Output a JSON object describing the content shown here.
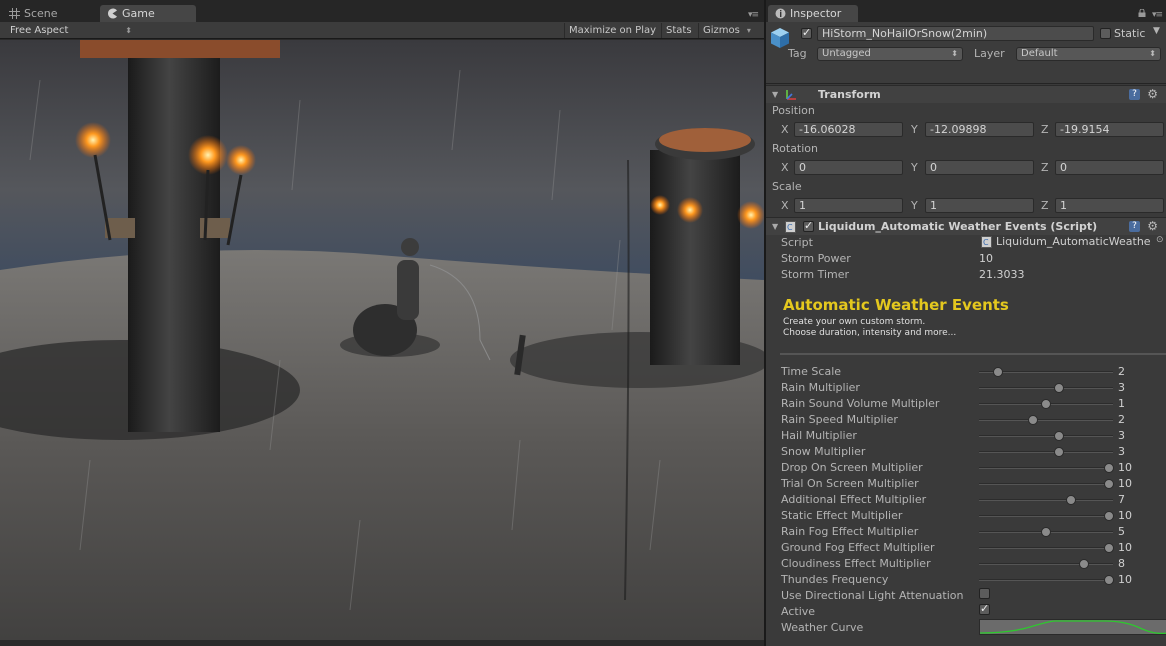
{
  "left_tabs": {
    "scene": "Scene",
    "game": "Game"
  },
  "game_toolbar": {
    "aspect": "Free Aspect",
    "maximize": "Maximize on Play",
    "stats": "Stats",
    "gizmos": "Gizmos"
  },
  "inspector": {
    "tab": "Inspector",
    "object_name": "HiStorm_NoHailOrSnow(2min)",
    "static_label": "Static",
    "tag_label": "Tag",
    "tag_value": "Untagged",
    "layer_label": "Layer",
    "layer_value": "Default",
    "transform": {
      "title": "Transform",
      "position_label": "Position",
      "rotation_label": "Rotation",
      "scale_label": "Scale",
      "position": {
        "x": "-16.06028",
        "y": "-12.09898",
        "z": "-19.9154"
      },
      "rotation": {
        "x": "0",
        "y": "0",
        "z": "0"
      },
      "scale": {
        "x": "1",
        "y": "1",
        "z": "1"
      },
      "x": "X",
      "y": "Y",
      "z": "Z"
    },
    "script_comp": {
      "title": "Liquidum_Automatic Weather Events (Script)",
      "script_label": "Script",
      "script_value": "Liquidum_AutomaticWeathe",
      "storm_power_label": "Storm Power",
      "storm_power": "10",
      "storm_timer_label": "Storm Timer",
      "storm_timer": "21.3033",
      "heading": "Automatic Weather Events",
      "desc1": "Create your own custom storm.",
      "desc2": "Choose duration, intensity and more...",
      "sliders": [
        {
          "label": "Time Scale",
          "value": "2",
          "pos": 0.14
        },
        {
          "label": "Rain Multiplier",
          "value": "3",
          "pos": 0.6
        },
        {
          "label": "Rain Sound Volume Multipler",
          "value": "1",
          "pos": 0.5
        },
        {
          "label": "Rain Speed Multiplier",
          "value": "2",
          "pos": 0.4
        },
        {
          "label": "Hail Multiplier",
          "value": "3",
          "pos": 0.6
        },
        {
          "label": "Snow Multiplier",
          "value": "3",
          "pos": 0.6
        },
        {
          "label": "Drop On Screen Multiplier",
          "value": "10",
          "pos": 0.97
        },
        {
          "label": "Trial On Screen Multiplier",
          "value": "10",
          "pos": 0.97
        },
        {
          "label": "Additional Effect Multiplier",
          "value": "7",
          "pos": 0.69
        },
        {
          "label": "Static Effect Multiplier",
          "value": "10",
          "pos": 0.97
        },
        {
          "label": "Rain Fog Effect Multiplier",
          "value": "5",
          "pos": 0.5
        },
        {
          "label": "Ground Fog Effect Multiplier",
          "value": "10",
          "pos": 0.97
        },
        {
          "label": "Cloudiness Effect Multiplier",
          "value": "8",
          "pos": 0.78
        },
        {
          "label": "Thundes Frequency",
          "value": "10",
          "pos": 0.97
        }
      ],
      "use_dir_light_label": "Use Directional Light Attenuation",
      "use_dir_light": false,
      "active_label": "Active",
      "active": true,
      "weather_curve_label": "Weather Curve"
    }
  },
  "colors": {
    "accent_heading": "#e4c81e",
    "curve": "#2ec82e",
    "torch": "#ff9a20"
  }
}
